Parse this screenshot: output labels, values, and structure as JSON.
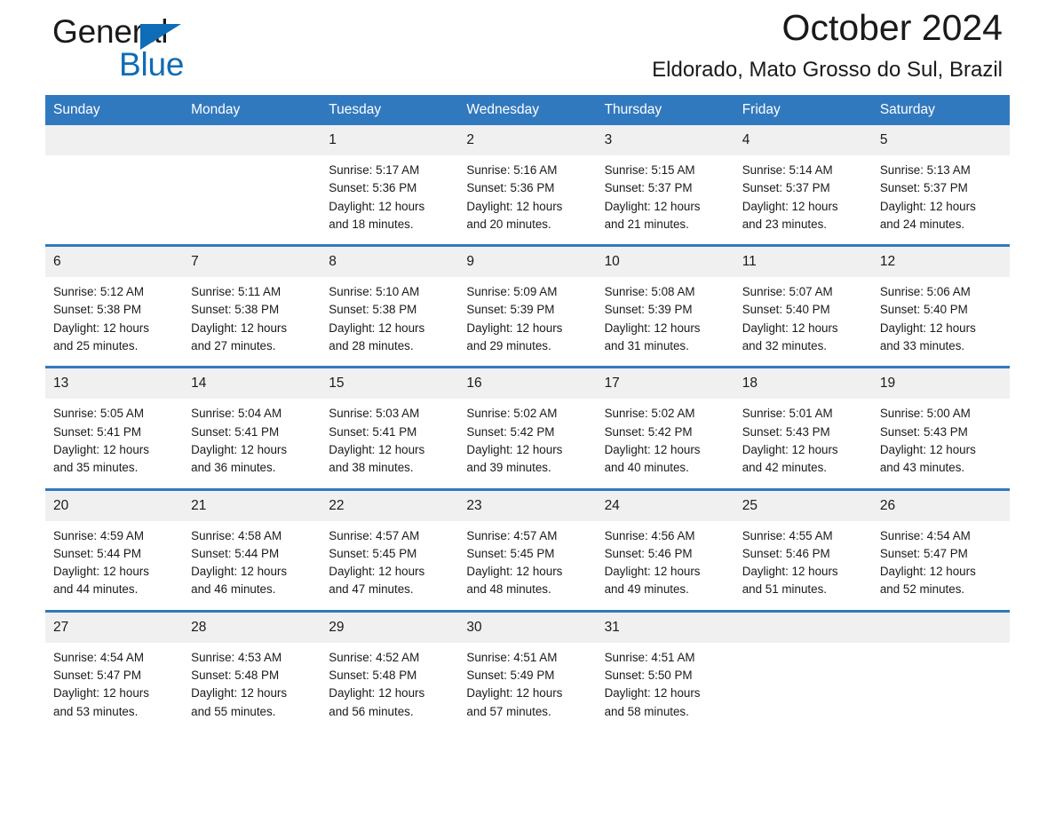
{
  "brand": {
    "name_part1": "General",
    "name_part2": "Blue",
    "accent_color": "#0f6cb6"
  },
  "header": {
    "title": "October 2024",
    "location": "Eldorado, Mato Grosso do Sul, Brazil"
  },
  "calendar": {
    "header_bg": "#3179be",
    "daynum_bg": "#f0f0f0",
    "weekday_names": [
      "Sunday",
      "Monday",
      "Tuesday",
      "Wednesday",
      "Thursday",
      "Friday",
      "Saturday"
    ],
    "labels": {
      "sunrise_prefix": "Sunrise: ",
      "sunset_prefix": "Sunset: ",
      "daylight_prefix": "Daylight: "
    },
    "weeks": [
      [
        {
          "day": "",
          "empty": true
        },
        {
          "day": "",
          "empty": true
        },
        {
          "day": "1",
          "sunrise": "Sunrise: 5:17 AM",
          "sunset": "Sunset: 5:36 PM",
          "daylight_l1": "Daylight: 12 hours",
          "daylight_l2": "and 18 minutes."
        },
        {
          "day": "2",
          "sunrise": "Sunrise: 5:16 AM",
          "sunset": "Sunset: 5:36 PM",
          "daylight_l1": "Daylight: 12 hours",
          "daylight_l2": "and 20 minutes."
        },
        {
          "day": "3",
          "sunrise": "Sunrise: 5:15 AM",
          "sunset": "Sunset: 5:37 PM",
          "daylight_l1": "Daylight: 12 hours",
          "daylight_l2": "and 21 minutes."
        },
        {
          "day": "4",
          "sunrise": "Sunrise: 5:14 AM",
          "sunset": "Sunset: 5:37 PM",
          "daylight_l1": "Daylight: 12 hours",
          "daylight_l2": "and 23 minutes."
        },
        {
          "day": "5",
          "sunrise": "Sunrise: 5:13 AM",
          "sunset": "Sunset: 5:37 PM",
          "daylight_l1": "Daylight: 12 hours",
          "daylight_l2": "and 24 minutes."
        }
      ],
      [
        {
          "day": "6",
          "sunrise": "Sunrise: 5:12 AM",
          "sunset": "Sunset: 5:38 PM",
          "daylight_l1": "Daylight: 12 hours",
          "daylight_l2": "and 25 minutes."
        },
        {
          "day": "7",
          "sunrise": "Sunrise: 5:11 AM",
          "sunset": "Sunset: 5:38 PM",
          "daylight_l1": "Daylight: 12 hours",
          "daylight_l2": "and 27 minutes."
        },
        {
          "day": "8",
          "sunrise": "Sunrise: 5:10 AM",
          "sunset": "Sunset: 5:38 PM",
          "daylight_l1": "Daylight: 12 hours",
          "daylight_l2": "and 28 minutes."
        },
        {
          "day": "9",
          "sunrise": "Sunrise: 5:09 AM",
          "sunset": "Sunset: 5:39 PM",
          "daylight_l1": "Daylight: 12 hours",
          "daylight_l2": "and 29 minutes."
        },
        {
          "day": "10",
          "sunrise": "Sunrise: 5:08 AM",
          "sunset": "Sunset: 5:39 PM",
          "daylight_l1": "Daylight: 12 hours",
          "daylight_l2": "and 31 minutes."
        },
        {
          "day": "11",
          "sunrise": "Sunrise: 5:07 AM",
          "sunset": "Sunset: 5:40 PM",
          "daylight_l1": "Daylight: 12 hours",
          "daylight_l2": "and 32 minutes."
        },
        {
          "day": "12",
          "sunrise": "Sunrise: 5:06 AM",
          "sunset": "Sunset: 5:40 PM",
          "daylight_l1": "Daylight: 12 hours",
          "daylight_l2": "and 33 minutes."
        }
      ],
      [
        {
          "day": "13",
          "sunrise": "Sunrise: 5:05 AM",
          "sunset": "Sunset: 5:41 PM",
          "daylight_l1": "Daylight: 12 hours",
          "daylight_l2": "and 35 minutes."
        },
        {
          "day": "14",
          "sunrise": "Sunrise: 5:04 AM",
          "sunset": "Sunset: 5:41 PM",
          "daylight_l1": "Daylight: 12 hours",
          "daylight_l2": "and 36 minutes."
        },
        {
          "day": "15",
          "sunrise": "Sunrise: 5:03 AM",
          "sunset": "Sunset: 5:41 PM",
          "daylight_l1": "Daylight: 12 hours",
          "daylight_l2": "and 38 minutes."
        },
        {
          "day": "16",
          "sunrise": "Sunrise: 5:02 AM",
          "sunset": "Sunset: 5:42 PM",
          "daylight_l1": "Daylight: 12 hours",
          "daylight_l2": "and 39 minutes."
        },
        {
          "day": "17",
          "sunrise": "Sunrise: 5:02 AM",
          "sunset": "Sunset: 5:42 PM",
          "daylight_l1": "Daylight: 12 hours",
          "daylight_l2": "and 40 minutes."
        },
        {
          "day": "18",
          "sunrise": "Sunrise: 5:01 AM",
          "sunset": "Sunset: 5:43 PM",
          "daylight_l1": "Daylight: 12 hours",
          "daylight_l2": "and 42 minutes."
        },
        {
          "day": "19",
          "sunrise": "Sunrise: 5:00 AM",
          "sunset": "Sunset: 5:43 PM",
          "daylight_l1": "Daylight: 12 hours",
          "daylight_l2": "and 43 minutes."
        }
      ],
      [
        {
          "day": "20",
          "sunrise": "Sunrise: 4:59 AM",
          "sunset": "Sunset: 5:44 PM",
          "daylight_l1": "Daylight: 12 hours",
          "daylight_l2": "and 44 minutes."
        },
        {
          "day": "21",
          "sunrise": "Sunrise: 4:58 AM",
          "sunset": "Sunset: 5:44 PM",
          "daylight_l1": "Daylight: 12 hours",
          "daylight_l2": "and 46 minutes."
        },
        {
          "day": "22",
          "sunrise": "Sunrise: 4:57 AM",
          "sunset": "Sunset: 5:45 PM",
          "daylight_l1": "Daylight: 12 hours",
          "daylight_l2": "and 47 minutes."
        },
        {
          "day": "23",
          "sunrise": "Sunrise: 4:57 AM",
          "sunset": "Sunset: 5:45 PM",
          "daylight_l1": "Daylight: 12 hours",
          "daylight_l2": "and 48 minutes."
        },
        {
          "day": "24",
          "sunrise": "Sunrise: 4:56 AM",
          "sunset": "Sunset: 5:46 PM",
          "daylight_l1": "Daylight: 12 hours",
          "daylight_l2": "and 49 minutes."
        },
        {
          "day": "25",
          "sunrise": "Sunrise: 4:55 AM",
          "sunset": "Sunset: 5:46 PM",
          "daylight_l1": "Daylight: 12 hours",
          "daylight_l2": "and 51 minutes."
        },
        {
          "day": "26",
          "sunrise": "Sunrise: 4:54 AM",
          "sunset": "Sunset: 5:47 PM",
          "daylight_l1": "Daylight: 12 hours",
          "daylight_l2": "and 52 minutes."
        }
      ],
      [
        {
          "day": "27",
          "sunrise": "Sunrise: 4:54 AM",
          "sunset": "Sunset: 5:47 PM",
          "daylight_l1": "Daylight: 12 hours",
          "daylight_l2": "and 53 minutes."
        },
        {
          "day": "28",
          "sunrise": "Sunrise: 4:53 AM",
          "sunset": "Sunset: 5:48 PM",
          "daylight_l1": "Daylight: 12 hours",
          "daylight_l2": "and 55 minutes."
        },
        {
          "day": "29",
          "sunrise": "Sunrise: 4:52 AM",
          "sunset": "Sunset: 5:48 PM",
          "daylight_l1": "Daylight: 12 hours",
          "daylight_l2": "and 56 minutes."
        },
        {
          "day": "30",
          "sunrise": "Sunrise: 4:51 AM",
          "sunset": "Sunset: 5:49 PM",
          "daylight_l1": "Daylight: 12 hours",
          "daylight_l2": "and 57 minutes."
        },
        {
          "day": "31",
          "sunrise": "Sunrise: 4:51 AM",
          "sunset": "Sunset: 5:50 PM",
          "daylight_l1": "Daylight: 12 hours",
          "daylight_l2": "and 58 minutes."
        },
        {
          "day": "",
          "empty": true
        },
        {
          "day": "",
          "empty": true
        }
      ]
    ]
  }
}
